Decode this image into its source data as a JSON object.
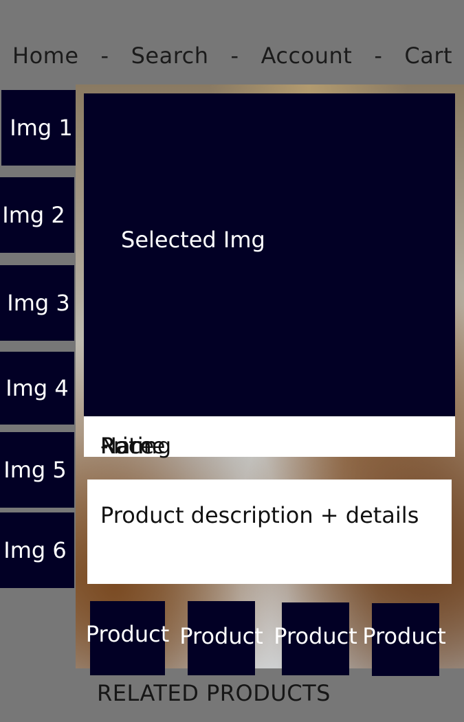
{
  "nav": {
    "home": "Home",
    "search": "Search",
    "account": "Account",
    "cart": "Cart",
    "separator": "-"
  },
  "thumbnails": [
    "Img 1",
    "Img 2",
    "Img 3",
    "Img 4",
    "Img 5",
    "Img 6"
  ],
  "selected_image": {
    "label": "Selected Img"
  },
  "product_info": {
    "name": "Name",
    "price": "Price",
    "rating": "Rating"
  },
  "description": {
    "text": "Product description + details"
  },
  "related": {
    "products": [
      "Product",
      "Product",
      "Product",
      "Product"
    ],
    "label": "RELATED PRODUCTS"
  },
  "colors": {
    "frame": "#777777",
    "tile": "#020025",
    "panel": "#ffffff"
  }
}
